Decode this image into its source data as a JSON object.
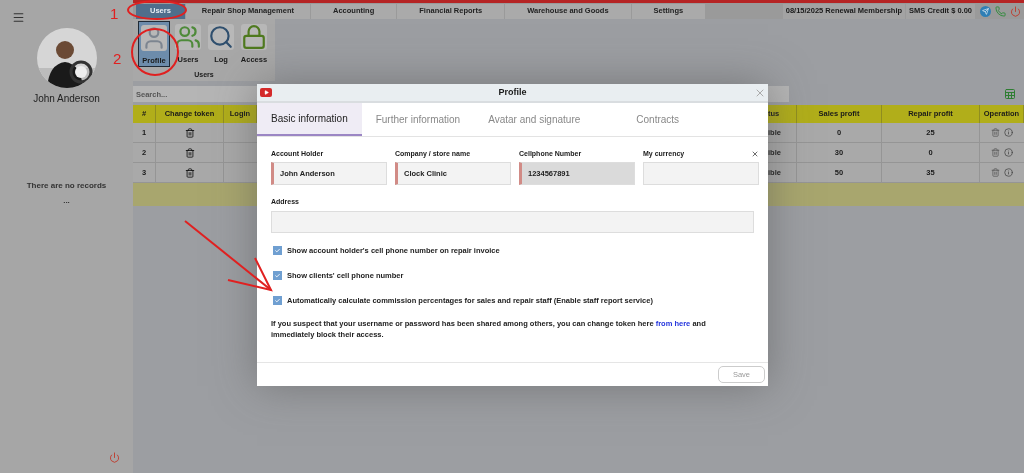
{
  "user": {
    "name": "John Anderson"
  },
  "sidebar_message": {
    "text": "There are no records",
    "more": "..."
  },
  "main_tabs": [
    {
      "label": "Users",
      "selected": true
    },
    {
      "label": "Repair Shop Management",
      "selected": false
    },
    {
      "label": "Accounting",
      "selected": false
    },
    {
      "label": "Financial Reports",
      "selected": false
    },
    {
      "label": "Warehouse and Goods",
      "selected": false
    },
    {
      "label": "Settings",
      "selected": false
    }
  ],
  "status": {
    "renewal": "08/15/2025 Renewal Membership",
    "sms_credit": "SMS Credit $ 0.00"
  },
  "ribbon": {
    "group": "Users",
    "buttons": [
      {
        "label": "Profile",
        "kind": "profile",
        "selected": true
      },
      {
        "label": "Users",
        "kind": "users",
        "selected": false
      },
      {
        "label": "Log",
        "kind": "log",
        "selected": false
      },
      {
        "label": "Access",
        "kind": "access",
        "selected": false
      }
    ]
  },
  "search": {
    "placeholder": "Search..."
  },
  "table": {
    "columns_left": [
      "#",
      "Change token",
      "Login"
    ],
    "columns_right": [
      "tus",
      "Sales profit",
      "Repair profit",
      "Operation"
    ],
    "rows": [
      {
        "number": "1",
        "status": "ible",
        "sales_profit": "0",
        "repair_profit": "25"
      },
      {
        "number": "2",
        "status": "ible",
        "sales_profit": "30",
        "repair_profit": "0"
      },
      {
        "number": "3",
        "status": "ible",
        "sales_profit": "50",
        "repair_profit": "35"
      }
    ]
  },
  "dialog": {
    "title": "Profile",
    "tabs": [
      {
        "label": "Basic information",
        "selected": true
      },
      {
        "label": "Further information",
        "selected": false
      },
      {
        "label": "Avatar and signature",
        "selected": false
      },
      {
        "label": "Contracts",
        "selected": false
      }
    ],
    "fields": [
      {
        "label": "Account Holder",
        "value": "John Anderson",
        "required": true,
        "disabled": false
      },
      {
        "label": "Company / store name",
        "value": "Clock Clinic",
        "required": true,
        "disabled": false
      },
      {
        "label": "Cellphone Number",
        "value": "1234567891",
        "required": true,
        "disabled": true
      },
      {
        "label": "My currency",
        "required": false,
        "disabled": false
      }
    ],
    "address": {
      "label": "Address"
    },
    "options": [
      {
        "label": "Show account holder's cell phone number on repair invoice",
        "checked": true
      },
      {
        "label": "Show clients' cell phone number",
        "checked": true
      },
      {
        "label": "Automatically calculate commission percentages for sales and repair staff (Enable staff report service)",
        "checked": true
      }
    ],
    "note": {
      "text": "If you suspect that your username or password has been shared among others, you can change token here",
      "link": "from here",
      "after": "and immediately block their access."
    },
    "save": "Save"
  },
  "annotations": [
    "1",
    "2"
  ]
}
